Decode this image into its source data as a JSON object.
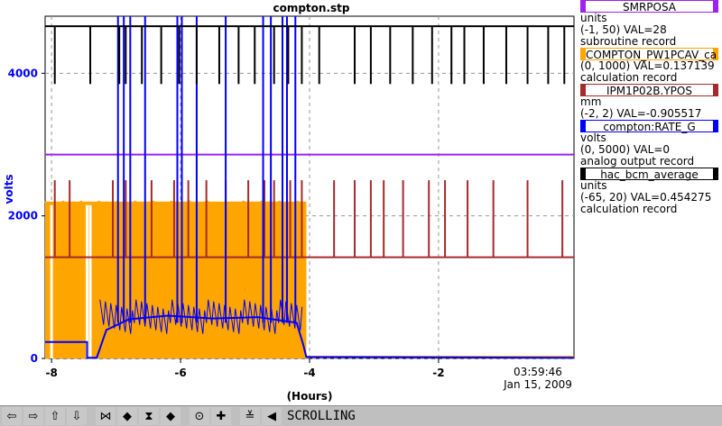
{
  "window": {
    "title": "compton.stp"
  },
  "legend": [
    {
      "name": "SMRPOSA",
      "unit": "units",
      "range_val": "(-1, 50) VAL=28",
      "record": "subroutine record",
      "color": "#a020f0"
    },
    {
      "name": "COMPTON_PW1PCAV_ca",
      "unit": "",
      "range_val": "(0, 1000) VAL=0.137139",
      "record": "calculation record",
      "color": "#ffa500"
    },
    {
      "name": "IPM1P02B.YPOS",
      "unit": "mm",
      "range_val": "(-2, 2) VAL=-0.905517",
      "record": "",
      "color": "#a52a2a"
    },
    {
      "name": "compton:RATE_G",
      "unit": "volts",
      "range_val": "(0, 5000) VAL=0",
      "record": "analog output record",
      "color": "#0000ff"
    },
    {
      "name": "hac_bcm_average",
      "unit": "units",
      "range_val": "(-65, 20) VAL=0.454275",
      "record": "calculation record",
      "color": "#000000"
    }
  ],
  "chart_data": {
    "type": "line",
    "title": "compton.stp",
    "xlabel": "(Hours)",
    "ylabel": "volts",
    "xlim": [
      -8.1,
      0.1
    ],
    "ylim": [
      0,
      4800
    ],
    "x_ticks": [
      -8,
      -6,
      -4,
      -2
    ],
    "x_tick_labels": [
      "-8",
      "-6",
      "-4",
      "-2"
    ],
    "y_ticks": [
      0,
      2000,
      4000
    ],
    "y_tick_labels": [
      "0",
      "2000",
      "4000"
    ],
    "time_label": "03:59:46",
    "date_label": "Jan 15, 2009",
    "grid": true,
    "series": [
      {
        "name": "SMRPOSA",
        "color": "#a020f0",
        "points": [
          [
            -8.1,
            2860
          ],
          [
            0.1,
            2860
          ]
        ]
      },
      {
        "name": "COMPTON_PW1PCAV_ca",
        "color": "#ffa500",
        "points": [
          [
            -8.1,
            2200
          ],
          [
            -4.05,
            2200
          ],
          [
            -4.05,
            20
          ],
          [
            0.1,
            20
          ]
        ]
      },
      {
        "name": "IPM1P02B.YPOS",
        "color": "#a52a2a",
        "points": [
          [
            -8.1,
            1420
          ],
          [
            0.1,
            1420
          ]
        ],
        "spikes_high": [
          -7.95,
          -7.72,
          -7.05,
          -6.85,
          -6.45,
          -6.1,
          -5.88,
          -5.6,
          -5.3,
          -4.95,
          -4.7,
          -4.55,
          -4.3,
          -4.12,
          -3.62,
          -3.3,
          -3.05,
          -2.85,
          -2.55,
          -2.15,
          -1.9,
          -1.55,
          -1.15,
          -0.62,
          -0.08
        ],
        "spike_high_value": 2500,
        "spike_low_value": 900
      },
      {
        "name": "compton:RATE_G",
        "color": "#0000ff",
        "points": [
          [
            -8.1,
            230
          ],
          [
            -7.45,
            230
          ],
          [
            -7.45,
            10
          ],
          [
            -7.3,
            10
          ],
          [
            -7.15,
            400
          ],
          [
            -6.8,
            550
          ],
          [
            -6.2,
            600
          ],
          [
            -5.5,
            560
          ],
          [
            -4.8,
            580
          ],
          [
            -4.2,
            500
          ],
          [
            -4.1,
            200
          ],
          [
            -4.05,
            20
          ],
          [
            0.1,
            10
          ]
        ],
        "spikes": [
          -6.97,
          -6.88,
          -6.78,
          -6.55,
          -6.05,
          -5.98,
          -5.75,
          -5.3,
          -4.72,
          -4.6,
          -4.42,
          -4.35,
          -4.22
        ],
        "spike_value": 4800
      },
      {
        "name": "hac_bcm_average",
        "color": "#000000",
        "points": [
          [
            -8.1,
            4660
          ],
          [
            0.1,
            4660
          ]
        ],
        "dips": [
          -7.95,
          -7.4,
          -6.95,
          -6.85,
          -6.6,
          -6.3,
          -6.02,
          -5.75,
          -5.4,
          -5.1,
          -4.85,
          -4.55,
          -4.33,
          -4.12,
          -3.85,
          -3.3,
          -3.05,
          -2.75,
          -2.4,
          -2.1,
          -1.8,
          -1.6,
          -1.3,
          -0.95,
          -0.62,
          -0.3,
          -0.05
        ],
        "dip_value": 3850
      }
    ]
  },
  "toolbar": {
    "buttons": [
      {
        "name": "scroll-left-button",
        "glyph": "⇦"
      },
      {
        "name": "scroll-right-button",
        "glyph": "⇨"
      },
      {
        "name": "scroll-up-button",
        "glyph": "⇧"
      },
      {
        "name": "scroll-down-button",
        "glyph": "⇩"
      },
      {
        "name": "expand-horizontal-button",
        "glyph": "⋈"
      },
      {
        "name": "compress-horizontal-button",
        "glyph": "◆"
      },
      {
        "name": "expand-vertical-button",
        "glyph": "⧗"
      },
      {
        "name": "compress-vertical-button",
        "glyph": "◆"
      },
      {
        "name": "zoom-out-button",
        "glyph": "⊙"
      },
      {
        "name": "zoom-in-button",
        "glyph": "✚"
      },
      {
        "name": "scale-button",
        "glyph": "≚"
      },
      {
        "name": "scroll-mode-button",
        "glyph": "◀"
      }
    ],
    "status": "SCROLLING"
  }
}
